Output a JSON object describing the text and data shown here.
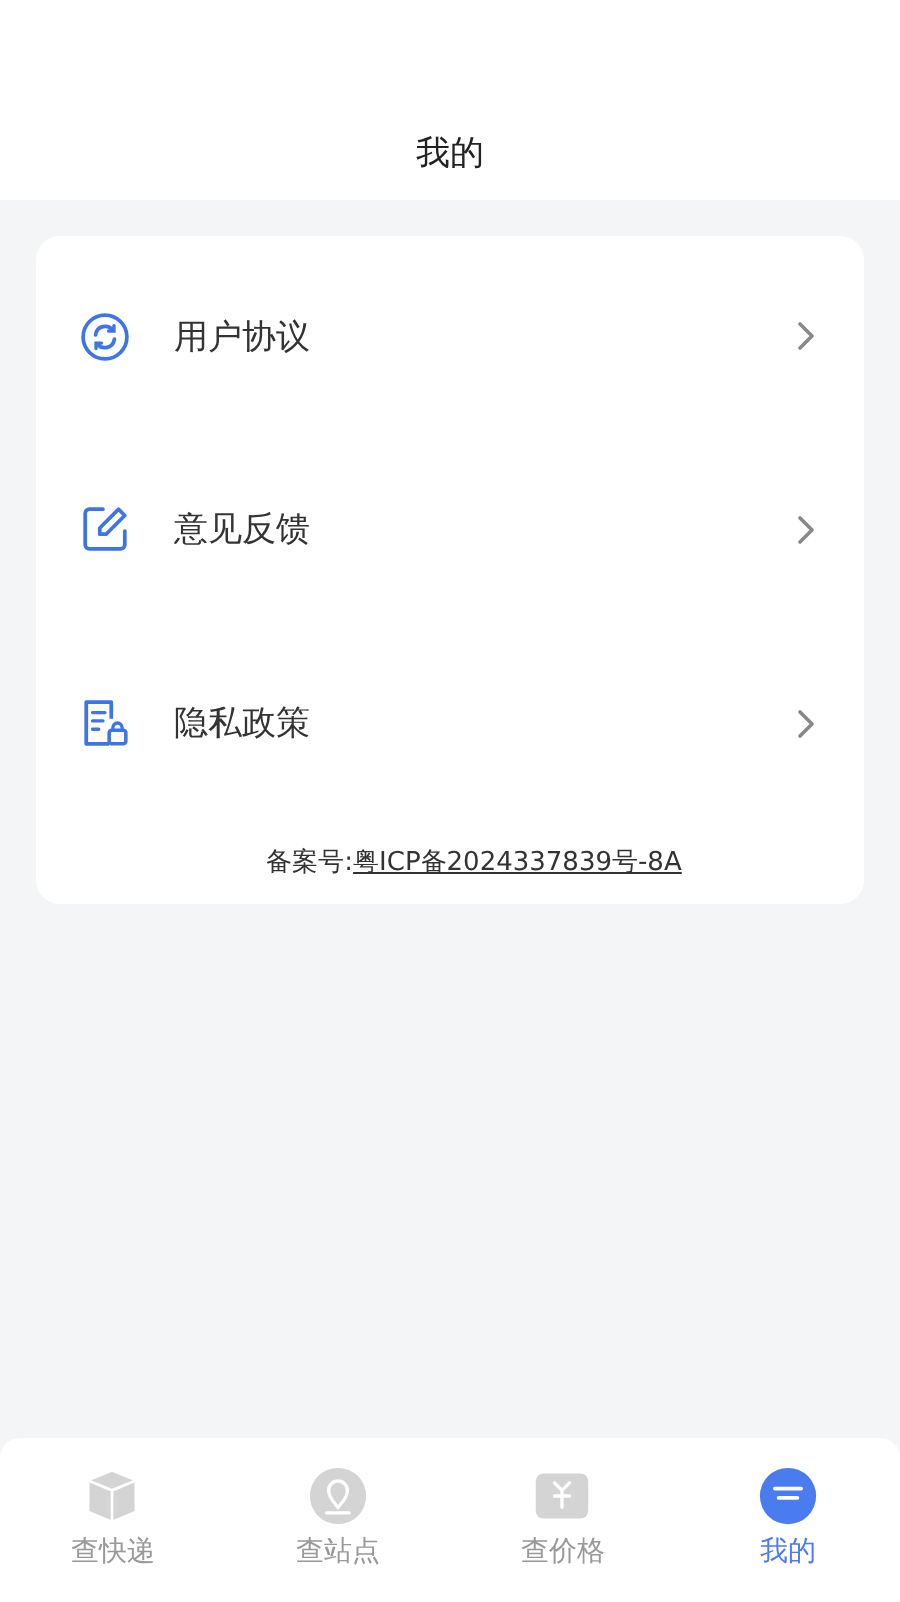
{
  "header": {
    "title": "我的"
  },
  "menu": [
    {
      "kind": "agreement",
      "label": "用户协议"
    },
    {
      "kind": "feedback",
      "label": "意见反馈"
    },
    {
      "kind": "privacy",
      "label": "隐私政策"
    }
  ],
  "record": {
    "label": "备案号:",
    "link": "粤ICP备2024337839号-8A"
  },
  "tabs": [
    {
      "kind": "parcel",
      "label": "查快递",
      "selected": false
    },
    {
      "kind": "station",
      "label": "查站点",
      "selected": false
    },
    {
      "kind": "price",
      "label": "查价格",
      "selected": false
    },
    {
      "kind": "mine",
      "label": "我的",
      "selected": true
    }
  ]
}
